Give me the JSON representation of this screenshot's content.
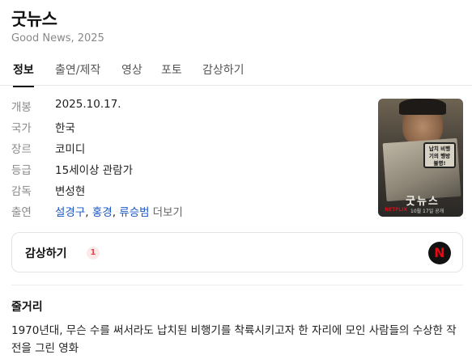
{
  "header": {
    "title": "굿뉴스",
    "subtitle": "Good News, 2025"
  },
  "tabs": [
    {
      "label": "정보",
      "active": true
    },
    {
      "label": "출연/제작",
      "active": false
    },
    {
      "label": "영상",
      "active": false
    },
    {
      "label": "포토",
      "active": false
    },
    {
      "label": "감상하기",
      "active": false
    }
  ],
  "info": {
    "release": {
      "key": "개봉",
      "value": "2025.10.17."
    },
    "country": {
      "key": "국가",
      "value": "한국"
    },
    "genre": {
      "key": "장르",
      "value": "코미디"
    },
    "rating": {
      "key": "등급",
      "value": "15세이상 관람가"
    },
    "director": {
      "key": "감독",
      "value": "변성현"
    },
    "cast": {
      "key": "출연",
      "names": [
        "설경구",
        "홍경",
        "류승범"
      ],
      "separator": ",",
      "more_label": "더보기"
    }
  },
  "poster": {
    "title_text": "굿뉴스",
    "badge_text": "납치 비행기의 행방불명!",
    "brand_text": "NETFLIX",
    "date_text": "10월 17일 공개"
  },
  "watch": {
    "label": "감상하기",
    "count": "1",
    "provider_icon": "netflix-icon",
    "provider_glyph": "N",
    "provider_color": "#e50914"
  },
  "plot": {
    "title": "줄거리",
    "text": "1970년대, 무슨 수를 써서라도 납치된 비행기를 착륙시키고자 한 자리에 모인 사람들의 수상한 작전을 그린 영화"
  }
}
